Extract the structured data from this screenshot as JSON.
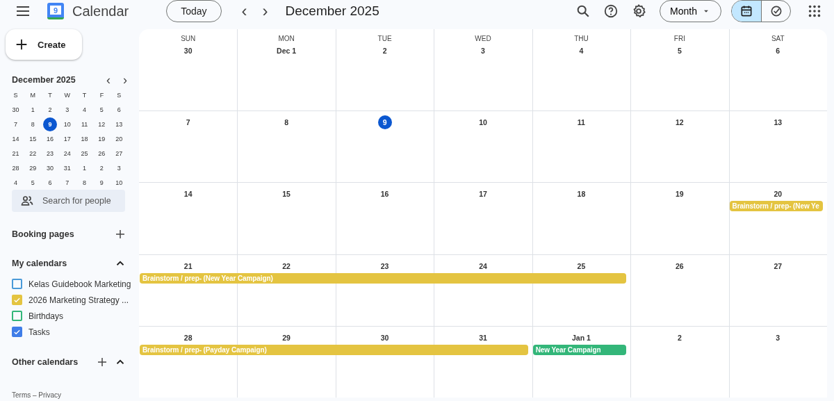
{
  "header": {
    "app_name": "Calendar",
    "logo_day": "9",
    "today_button": "Today",
    "prev": "‹",
    "next": "›",
    "title": "December 2025",
    "view_menu": "Month",
    "view_toggle": [
      {
        "kind": "calendar",
        "selected": true
      },
      {
        "kind": "tasks",
        "selected": false
      }
    ]
  },
  "sidebar": {
    "create_button": "Create",
    "mini_calendar": {
      "title": "December 2025",
      "weekdays": [
        "S",
        "M",
        "T",
        "W",
        "T",
        "F",
        "S"
      ],
      "weeks": [
        [
          {
            "date": "30",
            "today": false
          },
          {
            "date": "1",
            "today": false
          },
          {
            "date": "2",
            "today": false
          },
          {
            "date": "3",
            "today": false
          },
          {
            "date": "4",
            "today": false
          },
          {
            "date": "5",
            "today": false
          },
          {
            "date": "6",
            "today": false
          }
        ],
        [
          {
            "date": "7",
            "today": false
          },
          {
            "date": "8",
            "today": false
          },
          {
            "date": "9",
            "today": true
          },
          {
            "date": "10",
            "today": false
          },
          {
            "date": "11",
            "today": false
          },
          {
            "date": "12",
            "today": false
          },
          {
            "date": "13",
            "today": false
          }
        ],
        [
          {
            "date": "14",
            "today": false
          },
          {
            "date": "15",
            "today": false
          },
          {
            "date": "16",
            "today": false
          },
          {
            "date": "17",
            "today": false
          },
          {
            "date": "18",
            "today": false
          },
          {
            "date": "19",
            "today": false
          },
          {
            "date": "20",
            "today": false
          }
        ],
        [
          {
            "date": "21",
            "today": false
          },
          {
            "date": "22",
            "today": false
          },
          {
            "date": "23",
            "today": false
          },
          {
            "date": "24",
            "today": false
          },
          {
            "date": "25",
            "today": false
          },
          {
            "date": "26",
            "today": false
          },
          {
            "date": "27",
            "today": false
          }
        ],
        [
          {
            "date": "28",
            "today": false
          },
          {
            "date": "29",
            "today": false
          },
          {
            "date": "30",
            "today": false
          },
          {
            "date": "31",
            "today": false
          },
          {
            "date": "1",
            "today": false
          },
          {
            "date": "2",
            "today": false
          },
          {
            "date": "3",
            "today": false
          }
        ],
        [
          {
            "date": "4",
            "today": false
          },
          {
            "date": "5",
            "today": false
          },
          {
            "date": "6",
            "today": false
          },
          {
            "date": "7",
            "today": false
          },
          {
            "date": "8",
            "today": false
          },
          {
            "date": "9",
            "today": false
          },
          {
            "date": "10",
            "today": false
          }
        ]
      ]
    },
    "people_search": {
      "placeholder": "Search for people"
    },
    "booking_pages": "Booking pages",
    "my_calendars": {
      "title": "My calendars",
      "expanded": true,
      "items": [
        {
          "name": "Kelas Guidebook Marketing",
          "checked": false,
          "color": "#4a9ad8"
        },
        {
          "name": "2026 Marketing Strategy ...",
          "checked": true,
          "color": "#e4c441"
        },
        {
          "name": "Birthdays",
          "checked": false,
          "color": "#33b679"
        },
        {
          "name": "Tasks",
          "checked": true,
          "color": "#3f7de8"
        }
      ]
    },
    "other_calendars": {
      "title": "Other calendars",
      "expanded": true
    },
    "footer": "Terms – Privacy"
  },
  "month_grid": {
    "weekdays": [
      "SUN",
      "MON",
      "TUE",
      "WED",
      "THU",
      "FRI",
      "SAT"
    ],
    "weeks": [
      [
        {
          "date": "30",
          "today": false
        },
        {
          "date": "Dec 1",
          "today": false
        },
        {
          "date": "2",
          "today": false
        },
        {
          "date": "3",
          "today": false
        },
        {
          "date": "4",
          "today": false
        },
        {
          "date": "5",
          "today": false
        },
        {
          "date": "6",
          "today": false
        }
      ],
      [
        {
          "date": "7",
          "today": false
        },
        {
          "date": "8",
          "today": false
        },
        {
          "date": "9",
          "today": true
        },
        {
          "date": "10",
          "today": false
        },
        {
          "date": "11",
          "today": false
        },
        {
          "date": "12",
          "today": false
        },
        {
          "date": "13",
          "today": false
        }
      ],
      [
        {
          "date": "14",
          "today": false
        },
        {
          "date": "15",
          "today": false
        },
        {
          "date": "16",
          "today": false
        },
        {
          "date": "17",
          "today": false
        },
        {
          "date": "18",
          "today": false
        },
        {
          "date": "19",
          "today": false
        },
        {
          "date": "20",
          "today": false,
          "event": {
            "title": "Brainstorm / prep- (New Ye",
            "color": "#e4c441"
          }
        }
      ],
      [
        {
          "date": "21",
          "today": false,
          "event": {
            "title": "Brainstorm / prep- (New Year Campaign)",
            "color": "#e4c441"
          }
        },
        {
          "date": "22",
          "today": false,
          "continues_event": true
        },
        {
          "date": "23",
          "today": false,
          "continues_event": true
        },
        {
          "date": "24",
          "today": false,
          "continues_event": true
        },
        {
          "date": "25",
          "today": false,
          "continues_event": true
        },
        {
          "date": "26",
          "today": false
        },
        {
          "date": "27",
          "today": false
        }
      ],
      [
        {
          "date": "28",
          "today": false,
          "event": {
            "title": "Brainstorm / prep- (Payday Campaign)",
            "color": "#e4c441"
          }
        },
        {
          "date": "29",
          "today": false,
          "continues_event": true
        },
        {
          "date": "30",
          "today": false,
          "continues_event": true
        },
        {
          "date": "31",
          "today": false,
          "continues_event": true
        },
        {
          "date": "Jan 1",
          "today": false,
          "event": {
            "title": "New Year Campaign",
            "color": "#33b679"
          }
        },
        {
          "date": "2",
          "today": false
        },
        {
          "date": "3",
          "today": false
        }
      ]
    ]
  }
}
